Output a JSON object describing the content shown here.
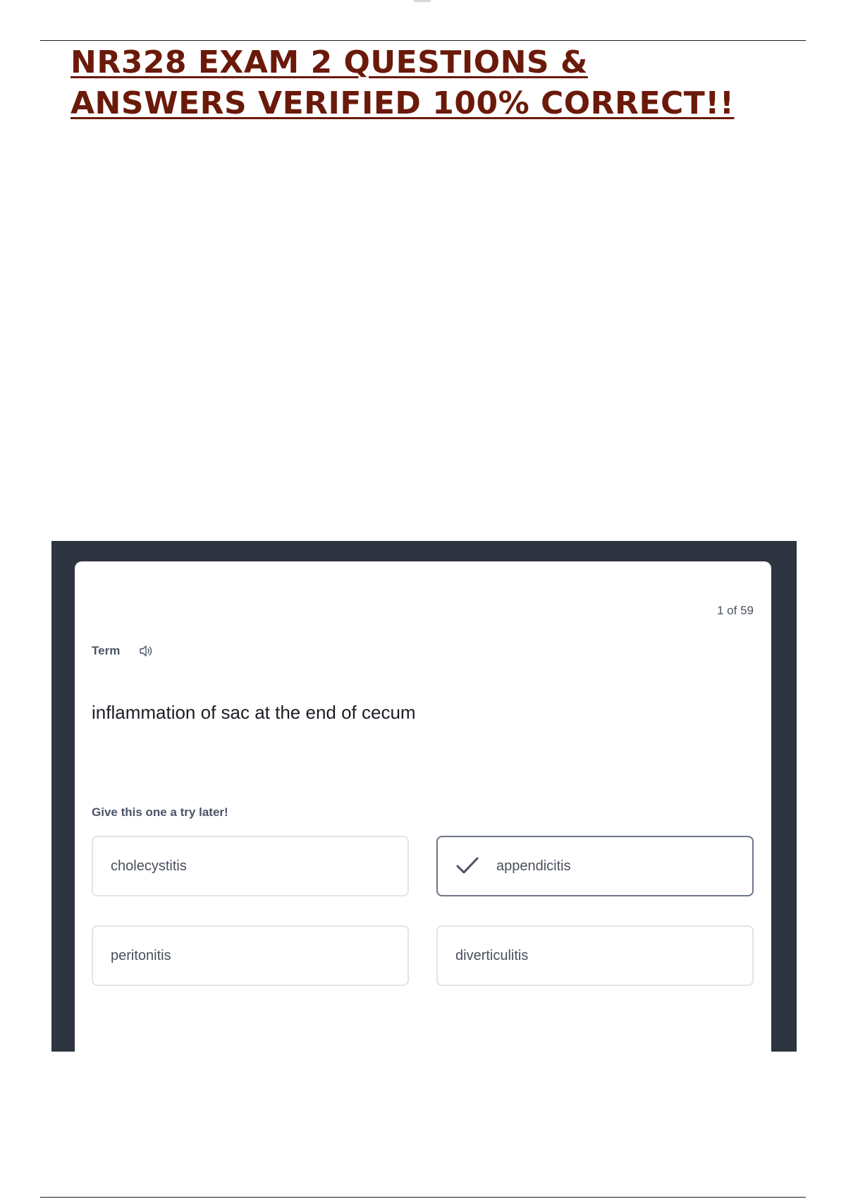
{
  "document": {
    "title_line1": "NR328 EXAM 2 QUESTIONS &",
    "title_line2": "ANSWERS VERIFIED 100% CORRECT!!",
    "title_color": "#6b1a0a"
  },
  "flashcard": {
    "counter": "1 of 59",
    "term_label": "Term",
    "term_text": "inflammation of sac at the end of cecum",
    "hint": "Give this one a try later!",
    "audio_icon": "speaker-icon",
    "options": [
      {
        "label": "cholecystitis",
        "selected": false
      },
      {
        "label": "appendicitis",
        "selected": true,
        "icon": "checkmark-icon"
      },
      {
        "label": "peritonitis",
        "selected": false
      },
      {
        "label": "diverticulitis",
        "selected": false
      }
    ],
    "frame_color": "#2e3440"
  }
}
